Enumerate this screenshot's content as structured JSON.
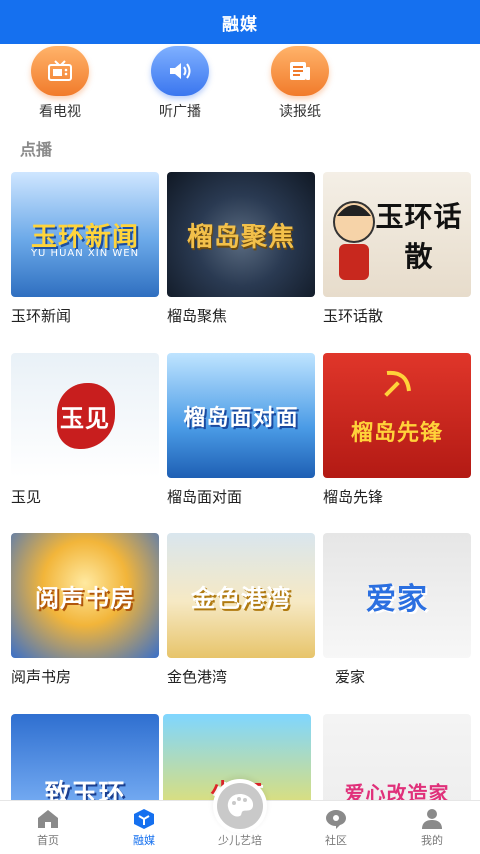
{
  "header": {
    "title": "融媒"
  },
  "quick_links": [
    {
      "label": "看电视",
      "icon": "tv-icon",
      "color": "#f17b2b"
    },
    {
      "label": "听广播",
      "icon": "speaker-icon",
      "color": "#3a76ef"
    },
    {
      "label": "读报纸",
      "icon": "newspaper-icon",
      "color": "#f17b2b"
    }
  ],
  "section": {
    "title": "点播"
  },
  "programs": [
    {
      "label": "玉环新闻",
      "thumb_text": "玉环新闻",
      "thumb_sub": "YU HUAN XIN WEN"
    },
    {
      "label": "榴岛聚焦",
      "thumb_text": "榴岛聚焦"
    },
    {
      "label": "玉环话散",
      "thumb_text": "玉环话散"
    },
    {
      "label": "玉见",
      "thumb_text": "玉见"
    },
    {
      "label": "榴岛面对面",
      "thumb_text": "榴岛面对面"
    },
    {
      "label": "榴岛先锋",
      "thumb_text": "榴岛先锋"
    },
    {
      "label": "阅声书房",
      "thumb_text": "阅声书房"
    },
    {
      "label": "金色港湾",
      "thumb_text": "金色港湾"
    },
    {
      "label": "爱家",
      "thumb_text": "爱家"
    },
    {
      "label": "",
      "thumb_text": "致玉环"
    },
    {
      "label": "",
      "thumb_text": "少年"
    },
    {
      "label": "",
      "thumb_text": "爱心改造家"
    }
  ],
  "tabbar": {
    "items": [
      {
        "label": "首页",
        "icon": "home-icon"
      },
      {
        "label": "融媒",
        "icon": "media-cube-icon",
        "active": true
      },
      {
        "label": "少儿艺培",
        "icon": "palette-icon"
      },
      {
        "label": "社区",
        "icon": "chat-bubble-icon"
      },
      {
        "label": "我的",
        "icon": "user-icon"
      }
    ],
    "active_color": "#1570ef"
  },
  "colors": {
    "brand": "#1570ef",
    "accent_orange": "#f17b2b",
    "accent_blue": "#3a76ef"
  }
}
